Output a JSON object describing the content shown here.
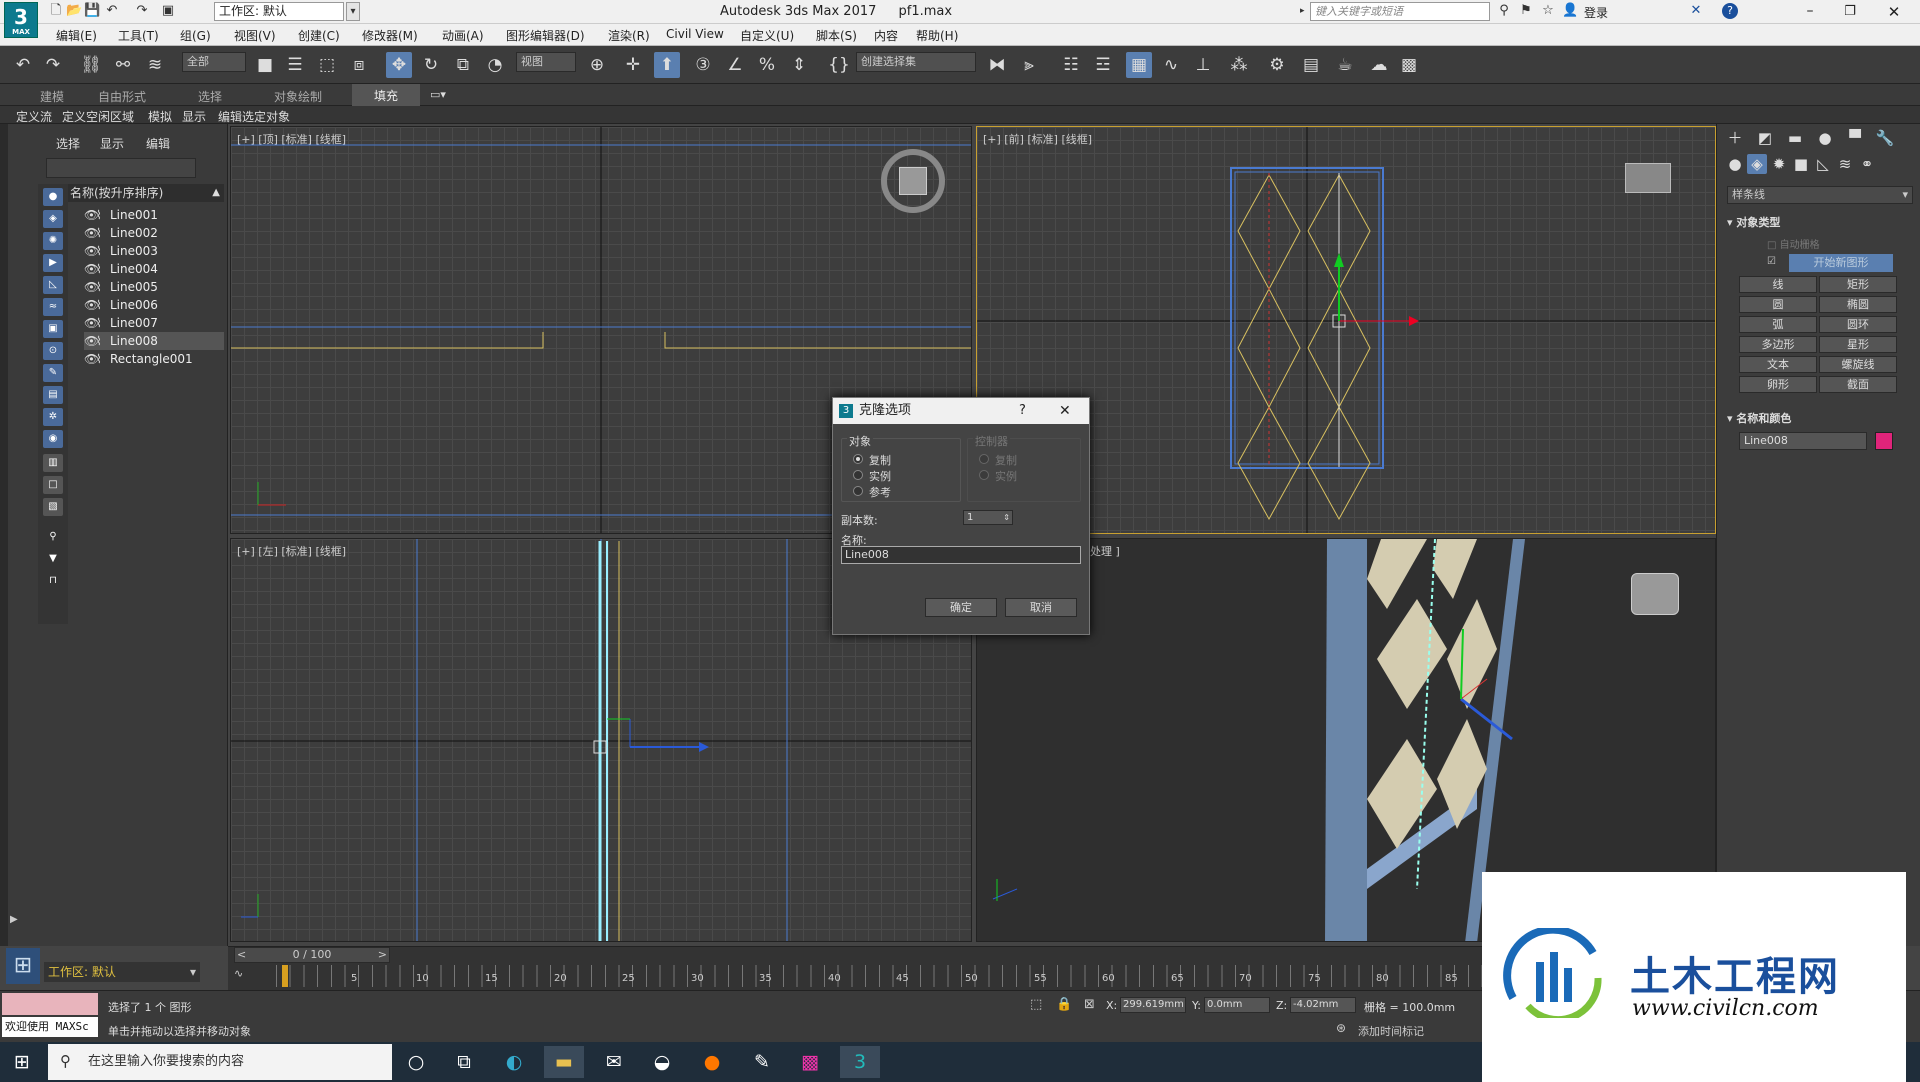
{
  "app": {
    "icon_label": "3",
    "icon_sub": "MAX",
    "title": "Autodesk 3ds Max 2017",
    "file": "pf1.max",
    "workspace": "工作区: 默认",
    "help_placeholder": "键入关键字或短语",
    "login": "登录"
  },
  "menus": [
    "编辑(E)",
    "工具(T)",
    "组(G)",
    "视图(V)",
    "创建(C)",
    "修改器(M)",
    "动画(A)",
    "图形编辑器(D)",
    "渲染(R)",
    "Civil View",
    "自定义(U)",
    "脚本(S)",
    "内容",
    "帮助(H)"
  ],
  "toolbar": {
    "filter": "全部",
    "view": "视图",
    "named_set": "创建选择集"
  },
  "ribbon": {
    "tabs": [
      "建模",
      "自由形式",
      "选择",
      "对象绘制",
      "填充"
    ],
    "subtabs": [
      "定义流",
      "定义空闲区域",
      "模拟",
      "显示",
      "编辑选定对象"
    ]
  },
  "explorer": {
    "tabs": [
      "选择",
      "显示",
      "编辑"
    ],
    "column": "名称(按升序排序)",
    "items": [
      "Line001",
      "Line002",
      "Line003",
      "Line004",
      "Line005",
      "Line006",
      "Line007",
      "Line008",
      "Rectangle001"
    ],
    "selected_index": 7,
    "workspace": "工作区: 默认"
  },
  "viewports": {
    "top": "[+] [顶] [标准] [线框]",
    "front": "[+] [前] [标准] [线框]",
    "left": "[+] [左] [标准] [线框]",
    "persp": "认明暗处理 ]"
  },
  "dialog": {
    "title": "克隆选项",
    "help": "?",
    "close": "✕",
    "object_group": "对象",
    "object_options": [
      "复制",
      "实例",
      "参考"
    ],
    "controller_group": "控制器",
    "controller_options": [
      "复制",
      "实例"
    ],
    "copies_label": "副本数:",
    "copies_value": "1",
    "name_label": "名称:",
    "name_value": "Line008",
    "ok": "确定",
    "cancel": "取消"
  },
  "command_panel": {
    "dropdown": "样条线",
    "rollout_types": "对象类型",
    "autogrid": "自动栅格",
    "start_new_shape": "开始新图形",
    "buttons": [
      "线",
      "矩形",
      "圆",
      "椭圆",
      "弧",
      "圆环",
      "多边形",
      "星形",
      "文本",
      "螺旋线",
      "卵形",
      "截面"
    ],
    "rollout_name": "名称和颜色",
    "object_name": "Line008",
    "object_color": "#e0247a"
  },
  "timeline": {
    "frame": "0 / 100",
    "ticks": [
      "5",
      "10",
      "15",
      "20",
      "25",
      "30",
      "35",
      "40",
      "45",
      "50",
      "55",
      "60",
      "65",
      "70",
      "75",
      "80",
      "85"
    ]
  },
  "status": {
    "selection": "选择了 1 个 图形",
    "prompt": "单击并拖动以选择并移动对象",
    "welcome": "欢迎使用 MAXSc",
    "x_label": "X:",
    "x": "299.619mm",
    "y_label": "Y:",
    "y": "0.0mm",
    "z_label": "Z:",
    "z": "-4.02mm",
    "grid": "栅格 = 100.0mm",
    "add_time_tag": "添加时间标记"
  },
  "taskbar": {
    "search_placeholder": "在这里输入你要搜索的内容"
  },
  "watermark": {
    "brand": "土木工程网",
    "url": "www.civilcn.com"
  }
}
